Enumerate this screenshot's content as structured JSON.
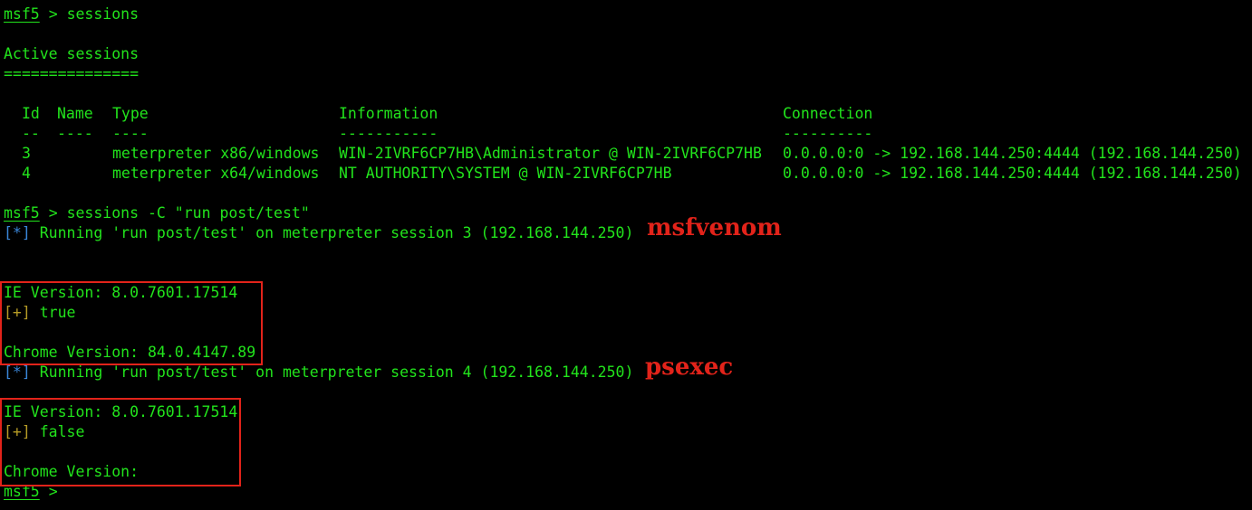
{
  "prompt": {
    "name": "msf5",
    "symbol": ">"
  },
  "commands": {
    "sessions": "sessions",
    "run": "sessions -C \"run post/test\""
  },
  "active_sessions": {
    "title": "Active sessions",
    "rule": "==============="
  },
  "table": {
    "headers": [
      "Id",
      "Name",
      "Type",
      "Information",
      "Connection"
    ],
    "underlines": [
      "--",
      "----",
      "----",
      "-----------",
      "----------"
    ],
    "rows": [
      {
        "id": "3",
        "name": "",
        "type": "meterpreter x86/windows",
        "info": "WIN-2IVRF6CP7HB\\Administrator @ WIN-2IVRF6CP7HB",
        "conn": "0.0.0.0:0 -> 192.168.144.250:4444 (192.168.144.250)"
      },
      {
        "id": "4",
        "name": "",
        "type": "meterpreter x64/windows",
        "info": "NT AUTHORITY\\SYSTEM @ WIN-2IVRF6CP7HB",
        "conn": "0.0.0.0:0 -> 192.168.144.250:4444 (192.168.144.250)"
      }
    ]
  },
  "run1": {
    "tag": "[*]",
    "msg": "Running 'run post/test' on meterpreter session 3 (192.168.144.250)",
    "annotation": "msfvenom",
    "ie": "IE Version: 8.0.7601.17514",
    "result_tag": "[+]",
    "result": "true",
    "chrome": "Chrome Version: 84.0.4147.89"
  },
  "run2": {
    "tag": "[*]",
    "msg": "Running 'run post/test' on meterpreter session 4 (192.168.144.250)",
    "annotation": "psexec",
    "ie": "IE Version: 8.0.7601.17514",
    "result_tag": "[+]",
    "result": "false",
    "chrome": "Chrome Version:"
  },
  "colors": {
    "text": "#22e41c",
    "info_tag": "#3a86d8",
    "good_tag": "#b59b26",
    "annotation": "#e2231a"
  }
}
